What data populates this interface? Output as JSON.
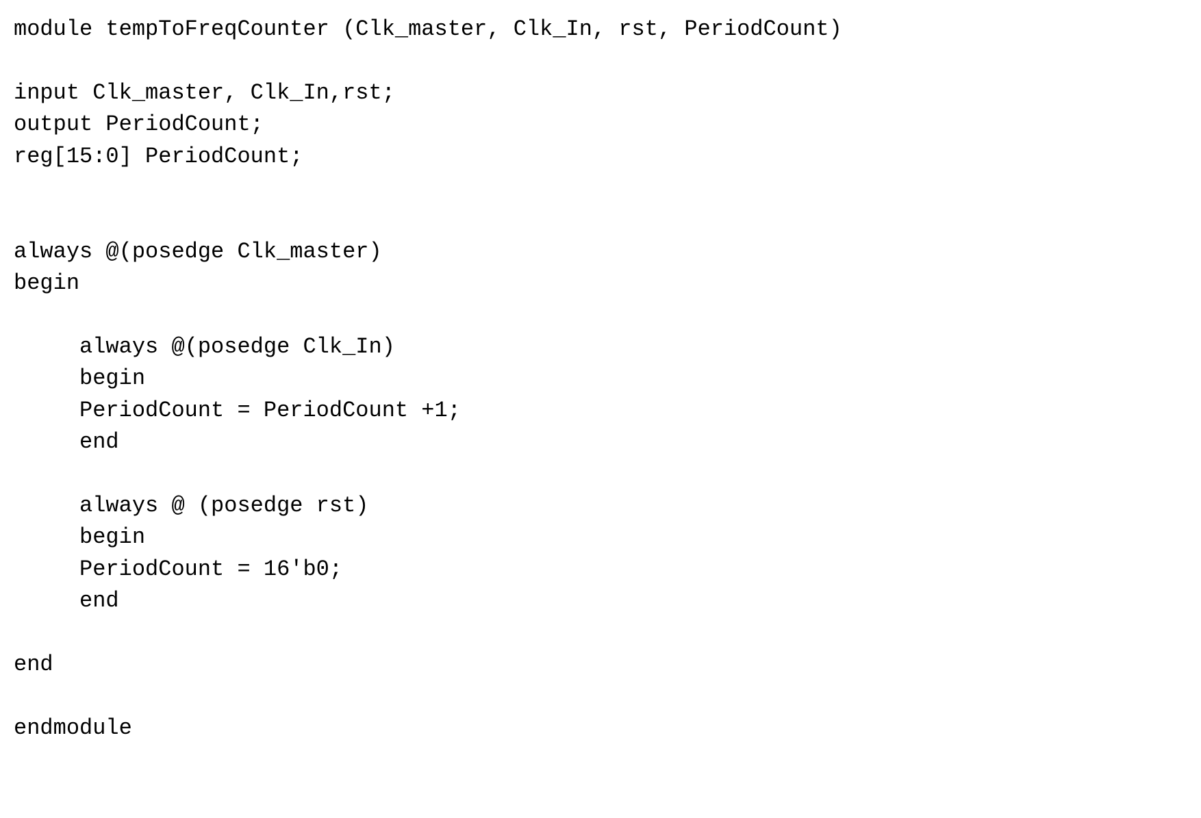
{
  "code": {
    "lines": [
      "module tempToFreqCounter (Clk_master, Clk_In, rst, PeriodCount)",
      "",
      "input Clk_master, Clk_In,rst;",
      "output PeriodCount;",
      "reg[15:0] PeriodCount;",
      "",
      "",
      "always @(posedge Clk_master)",
      "begin",
      "",
      "     always @(posedge Clk_In)",
      "     begin",
      "     PeriodCount = PeriodCount +1;",
      "     end",
      "",
      "     always @ (posedge rst)",
      "     begin",
      "     PeriodCount = 16'b0;",
      "     end",
      "",
      "end",
      "",
      "endmodule"
    ]
  }
}
